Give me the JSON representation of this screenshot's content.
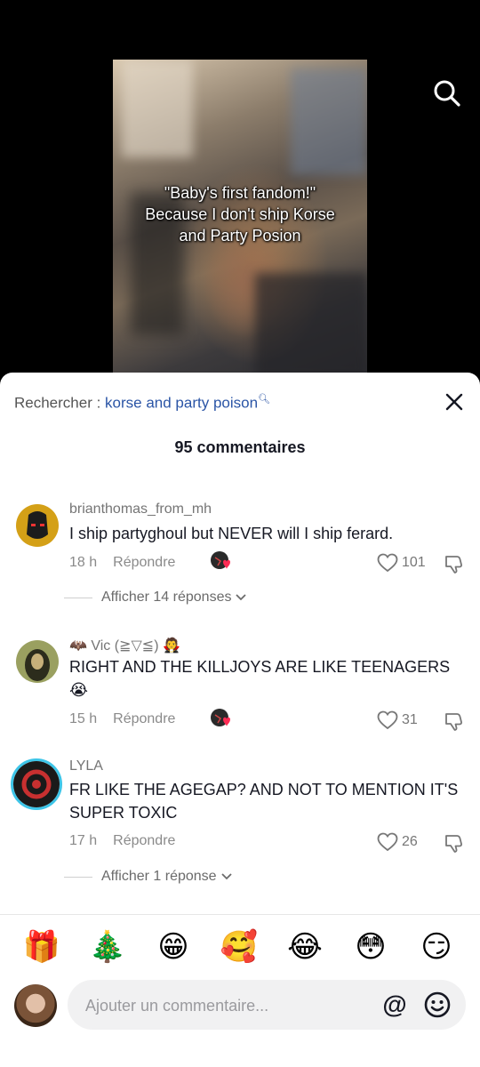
{
  "video": {
    "caption": "\"Baby's first fandom!\"\nBecause I don't ship Korse\nand Party Posion"
  },
  "search": {
    "label": "Rechercher : ",
    "query": "korse and party poison"
  },
  "comments_count": "95 commentaires",
  "comments": [
    {
      "username": "brianthomas_from_mh",
      "text": "I ship partyghoul but NEVER will I ship ferard.",
      "time": "18 h",
      "reply_label": "Répondre",
      "likes": "101",
      "replies": "Afficher 14 réponses"
    },
    {
      "username": "🦇 Vic (≧▽≦) 🧛",
      "text": "RIGHT AND THE KILLJOYS ARE LIKE TEENAGERS 😭",
      "time": "15 h",
      "reply_label": "Répondre",
      "likes": "31"
    },
    {
      "username": "LYLA",
      "text": "FR LIKE THE AGEGAP? AND NOT TO MENTION IT'S SUPER TOXIC",
      "time": "17 h",
      "reply_label": "Répondre",
      "likes": "26",
      "replies": "Afficher 1 réponse"
    }
  ],
  "emojis": [
    "🎁",
    "🎄",
    "😁",
    "🥰",
    "😂",
    "😳",
    "😏"
  ],
  "input": {
    "placeholder": "Ajouter un commentaire..."
  },
  "colors": {
    "accent_link": "#2b55a6",
    "creator_heart": "#fe2c55"
  }
}
